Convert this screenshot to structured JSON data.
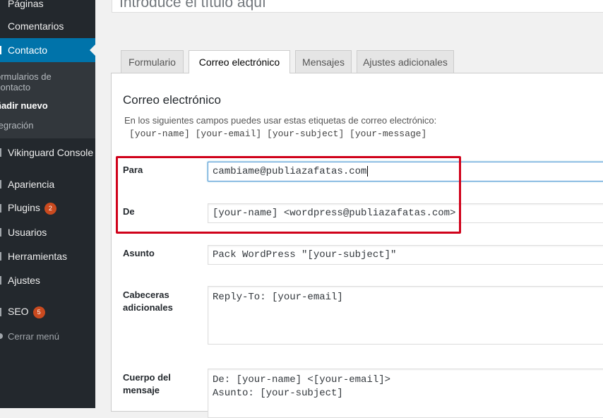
{
  "sidebar": {
    "items": [
      {
        "label": "Páginas"
      },
      {
        "label": "Comentarios"
      },
      {
        "label": "Contacto"
      },
      {
        "label": "Vikinguard Console"
      },
      {
        "label": "Apariencia"
      },
      {
        "label": "Plugins",
        "badge": "2"
      },
      {
        "label": "Usuarios"
      },
      {
        "label": "Herramientas"
      },
      {
        "label": "Ajustes"
      },
      {
        "label": "SEO",
        "badge": "5"
      }
    ],
    "submenu": [
      {
        "label": "ormularios de\ncontacto"
      },
      {
        "label": "ñadir nuevo"
      },
      {
        "label": "tegración"
      }
    ],
    "collapse_label": "Cerrar menú"
  },
  "title_field": {
    "placeholder": "Introduce el título aquí"
  },
  "tabs": [
    {
      "label": "Formulario"
    },
    {
      "label": "Correo electrónico"
    },
    {
      "label": "Mensajes"
    },
    {
      "label": "Ajustes adicionales"
    }
  ],
  "panel": {
    "title": "Correo electrónico",
    "description": "En los siguientes campos puedes usar estas etiquetas de correo electrónico:",
    "tags": "[your-name] [your-email] [your-subject] [your-message]"
  },
  "fields": {
    "to": {
      "label": "Para",
      "value": "cambiame@publiazafatas.com"
    },
    "from": {
      "label": "De",
      "value": "[your-name] <wordpress@publiazafatas.com>"
    },
    "subject": {
      "label": "Asunto",
      "value": "Pack WordPress \"[your-subject]\""
    },
    "headers": {
      "label": "Cabeceras adicionales",
      "value": "Reply-To: [your-email]"
    },
    "body": {
      "label": "Cuerpo del mensaje",
      "value": "De: [your-name] <[your-email]>\nAsunto: [your-subject]"
    }
  },
  "colors": {
    "sidebar_bg": "#23282d",
    "active_menu": "#0073aa",
    "highlight": "#d0021b",
    "badge": "#ca4a1f"
  }
}
